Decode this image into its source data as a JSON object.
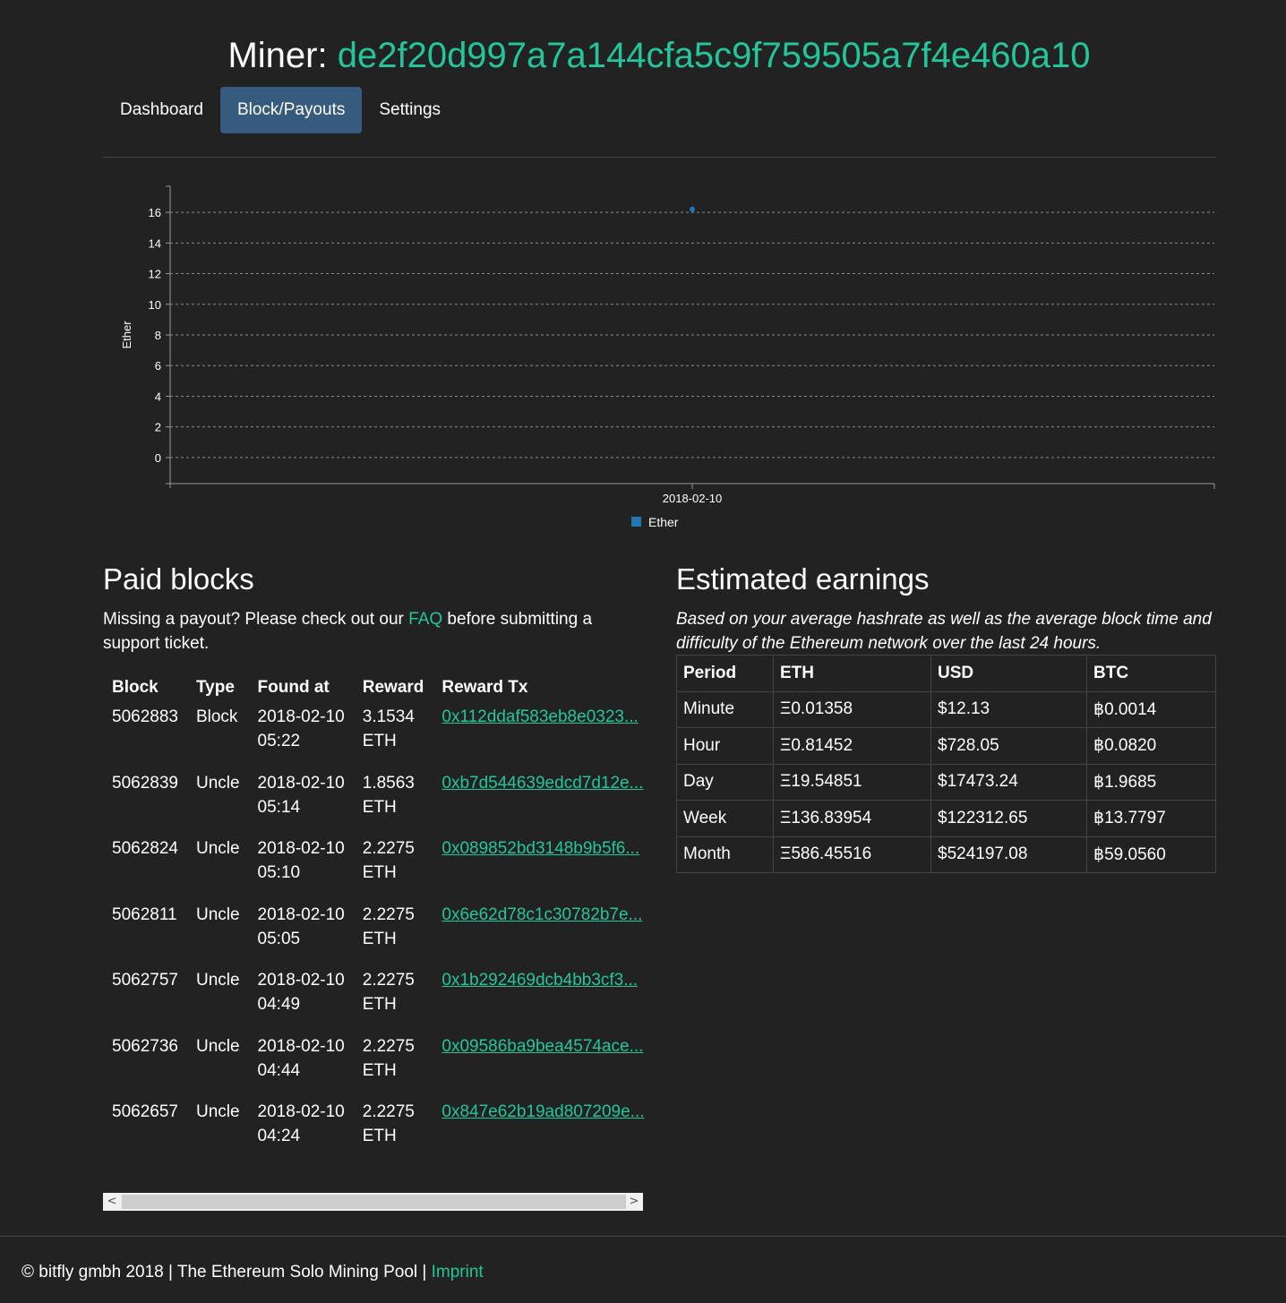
{
  "header": {
    "prefix": "Miner:",
    "address": "de2f20d997a7a144cfa5c9f759505a7f4e460a10"
  },
  "nav": {
    "dashboard": "Dashboard",
    "block_payouts": "Block/Payouts",
    "settings": "Settings"
  },
  "chart_data": {
    "type": "scatter",
    "title": "",
    "xlabel": "",
    "ylabel": "Ether",
    "x_ticks": [
      "2018-02-10"
    ],
    "y_ticks": [
      0,
      2,
      4,
      6,
      8,
      10,
      12,
      14,
      16
    ],
    "ylim": [
      -1.7,
      17.7
    ],
    "grid": true,
    "legend": {
      "position": "bottom-center"
    },
    "series": [
      {
        "name": "Ether",
        "color": "#1f77b4",
        "points": [
          {
            "x": "2018-02-10",
            "y": 16.2
          }
        ]
      }
    ]
  },
  "paid": {
    "title": "Paid blocks",
    "note_before": "Missing a payout? Please check out our ",
    "note_link": "FAQ",
    "note_after": " before submitting a support ticket.",
    "headers": [
      "Block",
      "Type",
      "Found at",
      "Reward",
      "Reward Tx"
    ],
    "rows": [
      {
        "block": "5062883",
        "type": "Block",
        "date": "2018-02-10",
        "time": "05:22",
        "reward": "3.1534",
        "unit": "ETH",
        "tx": "0x112ddaf583eb8e0323..."
      },
      {
        "block": "5062839",
        "type": "Uncle",
        "date": "2018-02-10",
        "time": "05:14",
        "reward": "1.8563",
        "unit": "ETH",
        "tx": "0xb7d544639edcd7d12e..."
      },
      {
        "block": "5062824",
        "type": "Uncle",
        "date": "2018-02-10",
        "time": "05:10",
        "reward": "2.2275",
        "unit": "ETH",
        "tx": "0x089852bd3148b9b5f6..."
      },
      {
        "block": "5062811",
        "type": "Uncle",
        "date": "2018-02-10",
        "time": "05:05",
        "reward": "2.2275",
        "unit": "ETH",
        "tx": "0x6e62d78c1c30782b7e..."
      },
      {
        "block": "5062757",
        "type": "Uncle",
        "date": "2018-02-10",
        "time": "04:49",
        "reward": "2.2275",
        "unit": "ETH",
        "tx": "0x1b292469dcb4bb3cf3..."
      },
      {
        "block": "5062736",
        "type": "Uncle",
        "date": "2018-02-10",
        "time": "04:44",
        "reward": "2.2275",
        "unit": "ETH",
        "tx": "0x09586ba9bea4574ace..."
      },
      {
        "block": "5062657",
        "type": "Uncle",
        "date": "2018-02-10",
        "time": "04:24",
        "reward": "2.2275",
        "unit": "ETH",
        "tx": "0x847e62b19ad807209e..."
      }
    ],
    "scroll_left": "<",
    "scroll_right": ">"
  },
  "earnings": {
    "title": "Estimated earnings",
    "note": "Based on your average hashrate as well as the average block time and difficulty of the Ethereum network over the last 24 hours.",
    "headers": [
      "Period",
      "ETH",
      "USD",
      "BTC"
    ],
    "rows": [
      {
        "period": "Minute",
        "eth": "Ξ0.01358",
        "usd": "$12.13",
        "btc": "฿0.0014"
      },
      {
        "period": "Hour",
        "eth": "Ξ0.81452",
        "usd": "$728.05",
        "btc": "฿0.0820"
      },
      {
        "period": "Day",
        "eth": "Ξ19.54851",
        "usd": "$17473.24",
        "btc": "฿1.9685"
      },
      {
        "period": "Week",
        "eth": "Ξ136.83954",
        "usd": "$122312.65",
        "btc": "฿13.7797"
      },
      {
        "period": "Month",
        "eth": "Ξ586.45516",
        "usd": "$524197.08",
        "btc": "฿59.0560"
      }
    ]
  },
  "footer": {
    "text": "© bitfly gmbh 2018 | The Ethereum Solo Mining Pool | ",
    "link": "Imprint"
  },
  "colors": {
    "accent": "#23c69a",
    "background": "#222222",
    "active_tab": "#375a7f",
    "series": "#1f77b4"
  }
}
